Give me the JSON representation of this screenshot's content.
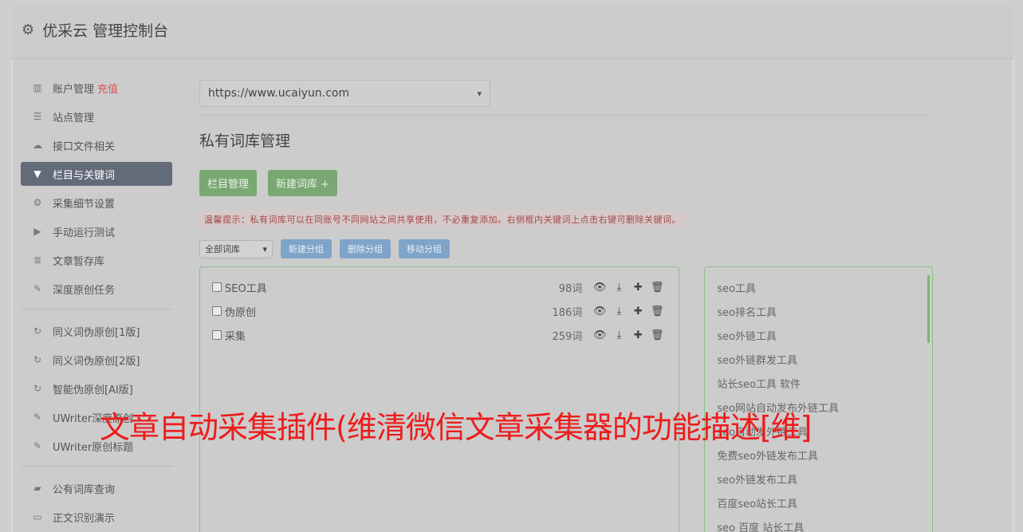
{
  "header": {
    "title": "优采云 管理控制台",
    "icon": "gear-icon"
  },
  "sidebar": {
    "group1": [
      {
        "label": "账户管理",
        "extra": "充值",
        "icon": "bar-chart-icon"
      },
      {
        "label": "站点管理",
        "icon": "server-icon"
      },
      {
        "label": "接口文件相关",
        "icon": "cloud-upload-icon"
      },
      {
        "label": "栏目与关键词",
        "icon": "filter-icon",
        "active": true
      },
      {
        "label": "采集细节设置",
        "icon": "cogs-icon"
      },
      {
        "label": "手动运行测试",
        "icon": "play-circle-icon"
      },
      {
        "label": "文章暂存库",
        "icon": "database-icon"
      },
      {
        "label": "深度原创任务",
        "icon": "edit-icon"
      }
    ],
    "group2": [
      {
        "label": "同义词伪原创[1版]",
        "icon": "refresh-icon"
      },
      {
        "label": "同义词伪原创[2版]",
        "icon": "refresh-icon"
      },
      {
        "label": "智能伪原创[AI版]",
        "icon": "refresh-icon"
      },
      {
        "label": "UWriter深度原创",
        "icon": "edit-icon"
      },
      {
        "label": "UWriter原创标题",
        "icon": "edit-icon"
      }
    ],
    "group3": [
      {
        "label": "公有词库查询",
        "icon": "book-icon"
      },
      {
        "label": "正文识别演示",
        "icon": "monitor-icon"
      }
    ]
  },
  "main": {
    "site_select": "https://www.ucaiyun.com",
    "title": "私有词库管理",
    "btn_column": "栏目管理",
    "btn_new_lib": "新建词库 +",
    "tip": "温馨提示：私有词库可以在同账号不同网站之间共享使用，不必重复添加。右侧框内关键词上点击右键可删除关键词。",
    "lib_filter": "全部词库",
    "btn_new_group": "新建分组",
    "btn_delete_group": "删除分组",
    "btn_move_group": "移动分组",
    "libraries": [
      {
        "name": "SEO工具",
        "count": "98词"
      },
      {
        "name": "伪原创",
        "count": "186词"
      },
      {
        "name": "采集",
        "count": "259词"
      }
    ],
    "keywords": [
      "seo工具",
      "seo排名工具",
      "seo外链工具",
      "seo外链群发工具",
      "站长seo工具 软件",
      "seo网站自动发布外链工具",
      "seo自动发外链工具",
      "免费seo外链发布工具",
      "seo外链发布工具",
      "百度seo站长工具",
      "seo 百度 站长工具"
    ]
  },
  "overlay_text": "文章自动采集插件(维清微信文章采集器的功能描述[维]",
  "colors": {
    "active_nav": "#636a78",
    "green_button": "#7aa873",
    "blue_button": "#7fa4c9",
    "overlay": "#ee1c1c"
  }
}
